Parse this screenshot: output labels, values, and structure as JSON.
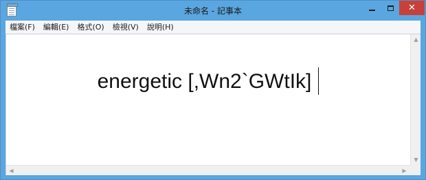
{
  "window": {
    "title": "未命名 - 記事本",
    "close_glyph": "✕"
  },
  "menubar": {
    "items": [
      {
        "label": "檔案(F)"
      },
      {
        "label": "編輯(E)"
      },
      {
        "label": "格式(O)"
      },
      {
        "label": "檢視(V)"
      },
      {
        "label": "說明(H)"
      }
    ]
  },
  "editor": {
    "text": "energetic [,Wn2`GWtIk]"
  },
  "scrollbars": {
    "up_glyph": "▲",
    "down_glyph": "▼",
    "left_glyph": "◀",
    "right_glyph": "▶"
  },
  "colors": {
    "titlebar": "#5aa6e0",
    "close_button": "#c7413a",
    "menubar": "#f5f6f7"
  },
  "icons": [
    "notepad-app-icon",
    "minimize-icon",
    "maximize-icon",
    "close-icon",
    "scroll-up-icon",
    "scroll-down-icon",
    "scroll-left-icon",
    "scroll-right-icon"
  ]
}
